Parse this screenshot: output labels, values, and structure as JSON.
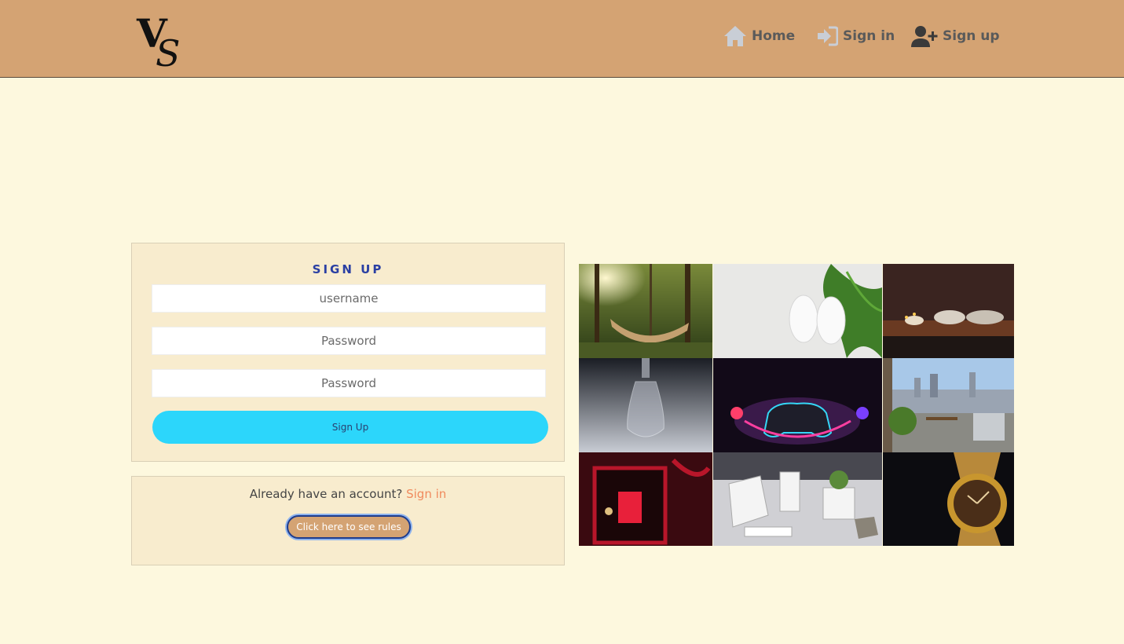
{
  "header": {
    "logo_alt": "VS",
    "nav": {
      "home": "Home",
      "signin": "Sign in",
      "signup": "Sign up"
    }
  },
  "signup_form": {
    "title": "SIGN UP",
    "username_placeholder": "username",
    "password_placeholder": "Password",
    "confirm_placeholder": "Password",
    "submit_label": "Sign Up"
  },
  "account": {
    "prompt": "Already have an account?",
    "signin_link": "Sign in",
    "rules_button": "Click here to see rules"
  },
  "gallery": {
    "images": [
      "hammock-in-forest",
      "white-sneakers-with-fern",
      "candles-on-tray",
      "glass-perfume-bottle",
      "neon-gaming-controller",
      "rooftop-patio-grill",
      "red-jewelry-box",
      "white-desk-organizer-plants",
      "gold-wristwatch"
    ]
  },
  "colors": {
    "header_bg": "#d4a373",
    "page_bg": "#fdf8de",
    "card_bg": "#f8ecce",
    "signup_button": "#2cd6fb",
    "link": "#f08a5d",
    "title": "#2a3fa3"
  }
}
